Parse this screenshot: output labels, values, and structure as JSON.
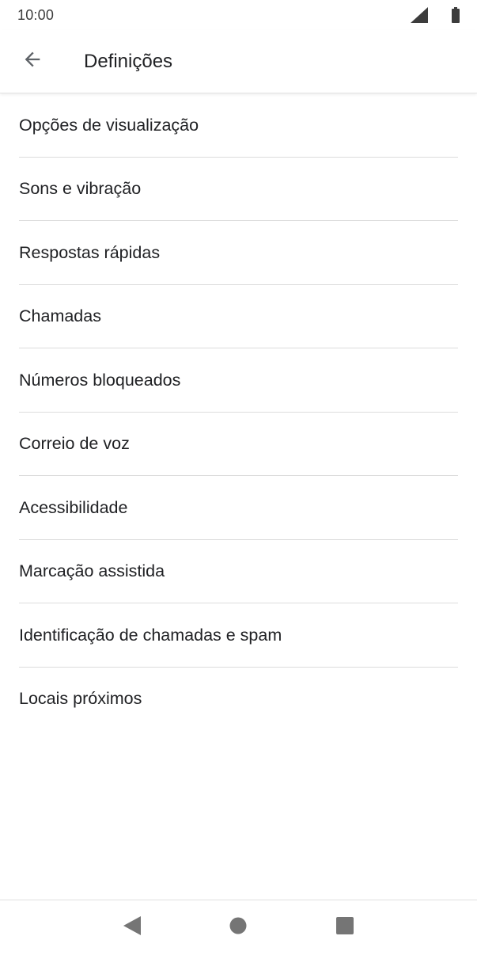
{
  "status_bar": {
    "time": "10:00",
    "icons": [
      "signal-icon",
      "battery-icon"
    ]
  },
  "app_bar": {
    "back_icon": "arrow-back-icon",
    "title": "Definições"
  },
  "settings": {
    "items": [
      {
        "label": "Opções de visualização"
      },
      {
        "label": "Sons e vibração"
      },
      {
        "label": "Respostas rápidas"
      },
      {
        "label": "Chamadas"
      },
      {
        "label": "Números bloqueados"
      },
      {
        "label": "Correio de voz"
      },
      {
        "label": "Acessibilidade"
      },
      {
        "label": "Marcação assistida"
      },
      {
        "label": "Identificação de chamadas e spam"
      },
      {
        "label": "Locais próximos"
      }
    ]
  },
  "nav_bar": {
    "buttons": [
      "back-triangle-icon",
      "home-circle-icon",
      "recents-square-icon"
    ]
  },
  "colors": {
    "text_primary": "#202124",
    "divider": "#dcdcdc",
    "icon_gray": "#5f6368",
    "nav_icon": "#757575"
  }
}
